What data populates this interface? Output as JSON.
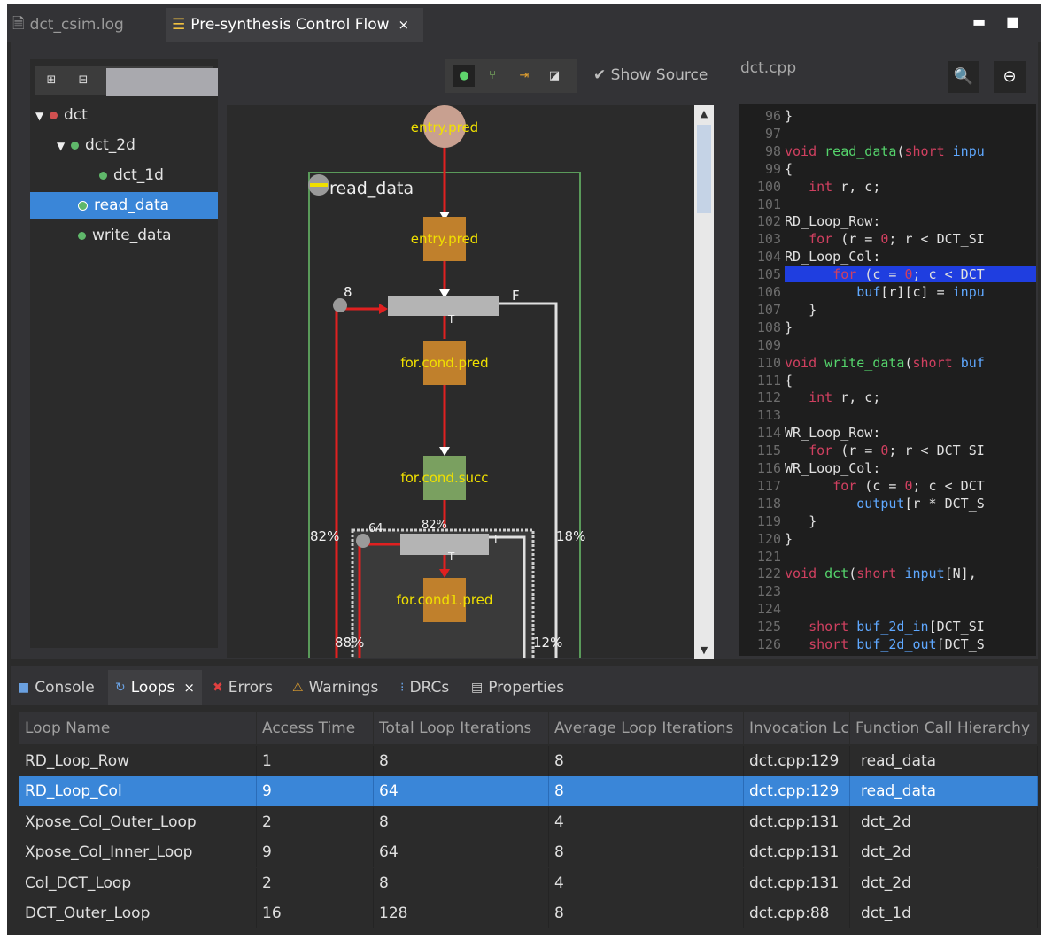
{
  "editor_tabs": [
    {
      "label": "dct_csim.log",
      "icon": "file-text-icon"
    },
    {
      "label": "Pre-synthesis Control Flow",
      "icon": "control-flow-icon",
      "close": "×"
    }
  ],
  "window_controls": {
    "minimize": "▬",
    "maximize": "■"
  },
  "outline": {
    "tree": [
      {
        "label": "dct",
        "expanded": true,
        "dot": "#d05050"
      },
      {
        "label": "dct_2d",
        "expanded": true,
        "dot": "#5fb86a"
      },
      {
        "label": "dct_1d",
        "dot": "#5fb86a"
      },
      {
        "label": "read_data",
        "selected": true,
        "dot": "#5fb86a"
      },
      {
        "label": "write_data",
        "dot": "#5fb86a"
      }
    ]
  },
  "graph": {
    "toolbar_icons": [
      "record-icon",
      "tree-icon",
      "arrows-icon",
      "expand-icon"
    ],
    "show_source_label": "Show Source",
    "nodes": {
      "entry_top": "entry.pred",
      "region": "read_data",
      "entry": "entry.pred",
      "for_cond": "for.cond.pred",
      "for_succ": "for.cond.succ",
      "for_cond1": "for.cond1.pred"
    },
    "edge_labels": {
      "eight": "8",
      "f1": "F",
      "t1": "T",
      "pct82": "82%",
      "sixtyfour": "64",
      "pct82b": "82%",
      "f2": "F",
      "t2": "T",
      "pct18": "18%",
      "pct88": "88%",
      "pct12": "12%"
    }
  },
  "code": {
    "file": "dct.cpp",
    "lines": [
      {
        "n": "96",
        "t": "}"
      },
      {
        "n": "97",
        "t": ""
      },
      {
        "n": "98",
        "t": "void read_data(short inpu"
      },
      {
        "n": "99",
        "t": "{"
      },
      {
        "n": "100",
        "t": "   int r, c;"
      },
      {
        "n": "101",
        "t": ""
      },
      {
        "n": "102",
        "t": "RD_Loop_Row:"
      },
      {
        "n": "103",
        "t": "   for (r = 0; r < DCT_SI"
      },
      {
        "n": "104",
        "t": "RD_Loop_Col:"
      },
      {
        "n": "105",
        "t": "      for (c = 0; c < DCT",
        "hl": true
      },
      {
        "n": "106",
        "t": "         buf[r][c] = inpu"
      },
      {
        "n": "107",
        "t": "   }"
      },
      {
        "n": "108",
        "t": "}"
      },
      {
        "n": "109",
        "t": ""
      },
      {
        "n": "110",
        "t": "void write_data(short buf"
      },
      {
        "n": "111",
        "t": "{"
      },
      {
        "n": "112",
        "t": "   int r, c;"
      },
      {
        "n": "113",
        "t": ""
      },
      {
        "n": "114",
        "t": "WR_Loop_Row:"
      },
      {
        "n": "115",
        "t": "   for (r = 0; r < DCT_SI"
      },
      {
        "n": "116",
        "t": "WR_Loop_Col:"
      },
      {
        "n": "117",
        "t": "      for (c = 0; c < DCT"
      },
      {
        "n": "118",
        "t": "         output[r * DCT_S"
      },
      {
        "n": "119",
        "t": "   }"
      },
      {
        "n": "120",
        "t": "}"
      },
      {
        "n": "121",
        "t": ""
      },
      {
        "n": "122",
        "t": "void dct(short input[N],"
      },
      {
        "n": "123",
        "t": ""
      },
      {
        "n": "124",
        "t": ""
      },
      {
        "n": "125",
        "t": "   short buf_2d_in[DCT_SI"
      },
      {
        "n": "126",
        "t": "   short buf_2d_out[DCT_S"
      }
    ]
  },
  "bottom_tabs": [
    {
      "label": "Console",
      "icon": "console-icon"
    },
    {
      "label": "Loops",
      "icon": "loops-icon",
      "active": true,
      "close": "×"
    },
    {
      "label": "Errors",
      "icon": "errors-icon"
    },
    {
      "label": "Warnings",
      "icon": "warnings-icon"
    },
    {
      "label": "DRCs",
      "icon": "drcs-icon"
    },
    {
      "label": "Properties",
      "icon": "properties-icon"
    }
  ],
  "loops_table": {
    "columns": [
      "Loop Name",
      "Access Time",
      "Total Loop Iterations",
      "Average Loop Iterations",
      "Invocation Lc",
      "Function Call Hierarchy"
    ],
    "rows": [
      [
        "RD_Loop_Row",
        "1",
        "8",
        "8",
        "dct.cpp:129",
        "read_data"
      ],
      [
        "RD_Loop_Col",
        "9",
        "64",
        "8",
        "dct.cpp:129",
        "read_data"
      ],
      [
        "Xpose_Col_Outer_Loop",
        "2",
        "8",
        "4",
        "dct.cpp:131",
        "dct_2d"
      ],
      [
        "Xpose_Col_Inner_Loop",
        "9",
        "64",
        "8",
        "dct.cpp:131",
        "dct_2d"
      ],
      [
        "Col_DCT_Loop",
        "2",
        "8",
        "4",
        "dct.cpp:131",
        "dct_2d"
      ],
      [
        "DCT_Outer_Loop",
        "16",
        "128",
        "8",
        "dct.cpp:88",
        "dct_1d"
      ]
    ],
    "selected_row": 1
  }
}
